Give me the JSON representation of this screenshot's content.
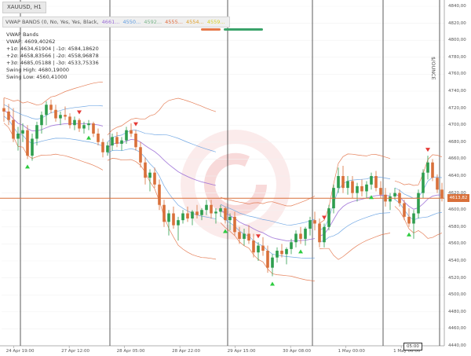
{
  "symbol": "XAUUSD, H1",
  "indicator": {
    "header_text": "VWAP BANDS (0, No, Yes, Yes, Black, ",
    "header_values": [
      {
        "text": "4661...",
        "color": "#9a6cd6"
      },
      {
        "text": "4550...",
        "color": "#5d9be0"
      },
      {
        "text": "4592...",
        "color": "#7ab58a"
      },
      {
        "text": "4555...",
        "color": "#e06a3c"
      },
      {
        "text": "4554...",
        "color": "#e0a12c"
      },
      {
        "text": "4559...",
        "color": "#d8d02a"
      }
    ],
    "header_swatch_colors": [
      "#e6784a",
      "#3aa36a"
    ],
    "info_lines": [
      "VWAP Bands",
      "VWAP: 4609,40262",
      "+1σ: 4634,61904 | -1σ: 4584,18620",
      "+2σ: 4658,83566 | -2σ: 4558,96878",
      "+3σ: 4685,05188 | -3σ: 4533,75336",
      "Swing High: 4680,19000",
      "Swing Low: 4560,41000"
    ]
  },
  "price_axis": {
    "labels": [
      "4840,00",
      "4820,00",
      "4800,00",
      "4780,00",
      "4760,00",
      "4740,00",
      "4720,00",
      "4700,00",
      "4680,00",
      "4660,00",
      "4640,00",
      "4620,00",
      "4600,00",
      "4580,00",
      "4560,00",
      "4540,00",
      "4520,00",
      "4500,00",
      "4480,00",
      "4460,00",
      "4440,00"
    ],
    "current_price": "4613,82"
  },
  "time_axis": {
    "labels": [
      "24 Apr 19:00",
      "27 Apr 12:00",
      "28 Apr 05:00",
      "28 Apr 22:00",
      "29 Apr 15:00",
      "30 Apr 08:00",
      "1 May 00:00",
      "1 May 06:00"
    ],
    "crosshair_time": "05:00"
  },
  "vertical_axis_label": "$/OUNCE",
  "chart_data": {
    "type": "candlestick",
    "symbol": "XAUUSD",
    "timeframe": "H1",
    "y_axis_range": [
      4440,
      4840
    ],
    "current_price": 4613.82,
    "ohlc": [
      [
        4720,
        4732,
        4704,
        4716
      ],
      [
        4716,
        4725,
        4700,
        4706
      ],
      [
        4706,
        4720,
        4680,
        4684
      ],
      [
        4684,
        4698,
        4670,
        4690
      ],
      [
        4690,
        4702,
        4680,
        4694
      ],
      [
        4694,
        4700,
        4660,
        4664
      ],
      [
        4664,
        4690,
        4658,
        4684
      ],
      [
        4684,
        4704,
        4676,
        4700
      ],
      [
        4700,
        4716,
        4690,
        4712
      ],
      [
        4712,
        4728,
        4700,
        4724
      ],
      [
        4724,
        4730,
        4714,
        4718
      ],
      [
        4718,
        4724,
        4704,
        4708
      ],
      [
        4708,
        4716,
        4700,
        4712
      ],
      [
        4712,
        4722,
        4706,
        4710
      ],
      [
        4710,
        4714,
        4696,
        4700
      ],
      [
        4700,
        4710,
        4694,
        4706
      ],
      [
        4706,
        4708,
        4692,
        4696
      ],
      [
        4696,
        4704,
        4690,
        4700
      ],
      [
        4700,
        4706,
        4694,
        4702
      ],
      [
        4702,
        4704,
        4686,
        4690
      ],
      [
        4690,
        4696,
        4676,
        4680
      ],
      [
        4680,
        4684,
        4662,
        4668
      ],
      [
        4668,
        4680,
        4664,
        4676
      ],
      [
        4676,
        4690,
        4670,
        4686
      ],
      [
        4686,
        4692,
        4674,
        4678
      ],
      [
        4678,
        4686,
        4670,
        4682
      ],
      [
        4682,
        4698,
        4678,
        4694
      ],
      [
        4694,
        4702,
        4686,
        4690
      ],
      [
        4690,
        4694,
        4670,
        4674
      ],
      [
        4674,
        4680,
        4650,
        4656
      ],
      [
        4656,
        4662,
        4630,
        4638
      ],
      [
        4638,
        4648,
        4622,
        4644
      ],
      [
        4644,
        4650,
        4626,
        4630
      ],
      [
        4630,
        4636,
        4600,
        4606
      ],
      [
        4606,
        4612,
        4580,
        4586
      ],
      [
        4586,
        4600,
        4570,
        4596
      ],
      [
        4596,
        4604,
        4578,
        4582
      ],
      [
        4582,
        4592,
        4564,
        4588
      ],
      [
        4588,
        4600,
        4584,
        4596
      ],
      [
        4596,
        4604,
        4586,
        4590
      ],
      [
        4590,
        4600,
        4582,
        4598
      ],
      [
        4598,
        4606,
        4590,
        4594
      ],
      [
        4594,
        4602,
        4588,
        4600
      ],
      [
        4600,
        4612,
        4594,
        4606
      ],
      [
        4606,
        4612,
        4590,
        4596
      ],
      [
        4596,
        4602,
        4584,
        4598
      ],
      [
        4598,
        4606,
        4592,
        4602
      ],
      [
        4602,
        4604,
        4584,
        4588
      ],
      [
        4588,
        4596,
        4576,
        4592
      ],
      [
        4592,
        4598,
        4570,
        4574
      ],
      [
        4574,
        4580,
        4560,
        4566
      ],
      [
        4566,
        4578,
        4558,
        4572
      ],
      [
        4572,
        4582,
        4560,
        4564
      ],
      [
        4564,
        4572,
        4544,
        4550
      ],
      [
        4550,
        4562,
        4540,
        4558
      ],
      [
        4558,
        4568,
        4546,
        4552
      ],
      [
        4552,
        4558,
        4526,
        4532
      ],
      [
        4532,
        4548,
        4522,
        4544
      ],
      [
        4544,
        4556,
        4538,
        4552
      ],
      [
        4552,
        4560,
        4544,
        4548
      ],
      [
        4548,
        4556,
        4536,
        4554
      ],
      [
        4554,
        4566,
        4548,
        4562
      ],
      [
        4562,
        4576,
        4556,
        4572
      ],
      [
        4572,
        4580,
        4560,
        4566
      ],
      [
        4566,
        4580,
        4558,
        4578
      ],
      [
        4578,
        4592,
        4570,
        4588
      ],
      [
        4588,
        4598,
        4576,
        4584
      ],
      [
        4584,
        4590,
        4556,
        4562
      ],
      [
        4562,
        4584,
        4556,
        4580
      ],
      [
        4580,
        4606,
        4576,
        4602
      ],
      [
        4602,
        4630,
        4596,
        4626
      ],
      [
        4626,
        4650,
        4620,
        4640
      ],
      [
        4640,
        4652,
        4620,
        4626
      ],
      [
        4626,
        4640,
        4618,
        4634
      ],
      [
        4634,
        4640,
        4614,
        4620
      ],
      [
        4620,
        4632,
        4610,
        4628
      ],
      [
        4628,
        4636,
        4616,
        4622
      ],
      [
        4622,
        4634,
        4614,
        4630
      ],
      [
        4630,
        4644,
        4624,
        4640
      ],
      [
        4640,
        4646,
        4622,
        4626
      ],
      [
        4626,
        4634,
        4614,
        4618
      ],
      [
        4618,
        4626,
        4604,
        4610
      ],
      [
        4610,
        4620,
        4600,
        4616
      ],
      [
        4616,
        4626,
        4612,
        4620
      ],
      [
        4620,
        4624,
        4604,
        4608
      ],
      [
        4608,
        4612,
        4588,
        4592
      ],
      [
        4592,
        4602,
        4580,
        4584
      ],
      [
        4584,
        4600,
        4566,
        4596
      ],
      [
        4596,
        4624,
        4590,
        4620
      ],
      [
        4620,
        4648,
        4614,
        4644
      ],
      [
        4644,
        4664,
        4636,
        4656
      ],
      [
        4656,
        4660,
        4634,
        4638
      ],
      [
        4638,
        4642,
        4620,
        4624
      ],
      [
        4624,
        4632,
        4610,
        4614
      ]
    ],
    "vwap_bands": {
      "vwap": 4609.40262,
      "plus_1_sigma": 4634.61904,
      "minus_1_sigma": 4584.1862,
      "plus_2_sigma": 4658.83566,
      "minus_2_sigma": 4558.96878,
      "plus_3_sigma": 4685.05188,
      "minus_3_sigma": 4533.75336,
      "swing_high": 4680.19,
      "swing_low": 4560.41
    },
    "session_starts": [
      0,
      22,
      46,
      67,
      83
    ],
    "vertical_marker_bars": [
      4,
      23,
      48,
      66,
      81,
      93
    ],
    "buy_signal_bars": [
      5,
      18,
      47,
      57,
      63,
      78,
      86
    ],
    "sell_signal_bars": [
      16,
      28,
      54,
      68,
      90
    ]
  }
}
